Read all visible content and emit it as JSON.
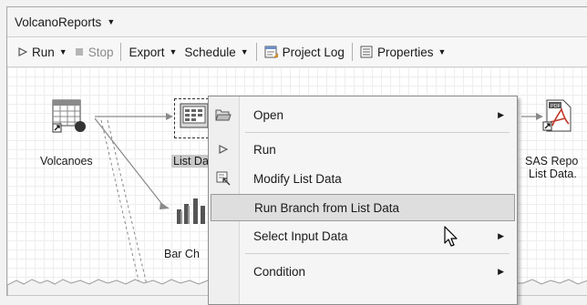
{
  "window": {
    "title": "VolcanoReports"
  },
  "toolbar": {
    "run": "Run",
    "stop": "Stop",
    "export": "Export",
    "schedule": "Schedule",
    "project_log": "Project Log",
    "properties": "Properties"
  },
  "nodes": {
    "volcanoes": "Volcanoes",
    "list_data": "List Da",
    "bar_chart": "Bar Ch",
    "sas_report_line1": "SAS Repo",
    "sas_report_line2": "List Data."
  },
  "context_menu": {
    "items": [
      {
        "label": "Open",
        "icon": "folder-open-icon",
        "submenu": true
      },
      {
        "label": "Run",
        "icon": "play-icon",
        "submenu": false
      },
      {
        "label": "Modify List Data",
        "icon": "modify-task-icon",
        "submenu": false
      },
      {
        "label": "Run Branch from List Data",
        "icon": "",
        "submenu": false,
        "highlighted": true
      },
      {
        "label": "Select Input Data",
        "icon": "",
        "submenu": true
      },
      {
        "label": "Condition",
        "icon": "",
        "submenu": true
      }
    ]
  },
  "colors": {
    "highlight": "#dedede",
    "menu_background": "#f5f5f5"
  }
}
